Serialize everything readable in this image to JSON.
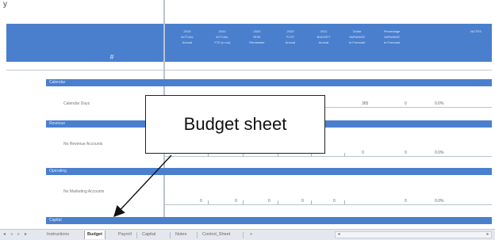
{
  "top_partial_text": "y",
  "header": {
    "hash": "#",
    "columns": [
      {
        "line1": "2019",
        "line2": "ACTUAL",
        "line3": "Annual"
      },
      {
        "line1": "2020",
        "line2": "ACTUAL",
        "line3": "YTD (n mo)"
      },
      {
        "line1": "2020",
        "line2": "RISK",
        "line3": "Remainder"
      },
      {
        "line1": "2020",
        "line2": "FCST",
        "line3": "Annual"
      },
      {
        "line1": "2021",
        "line2": "BUDGET",
        "line3": "Annual"
      },
      {
        "line1": "Dollar",
        "line2": "VARIANCE",
        "line3": "to Forecast"
      },
      {
        "line1": "Percentage",
        "line2": "VARIANCE",
        "line3": "to Forecast"
      },
      {
        "line1": "NOTES",
        "line2": "",
        "line3": ""
      }
    ]
  },
  "sections": [
    {
      "label": "Calendar",
      "row_label": "Calendar Days",
      "values": [
        "365",
        "0",
        "0.0%"
      ]
    },
    {
      "label": "Revenue",
      "row_label": "No Revenue Accounts",
      "values": [
        "0",
        "0",
        "0.0%"
      ]
    },
    {
      "label": "Operating",
      "row_label": "No Marketing Accounts",
      "values": [
        "0",
        "0",
        "0.0%"
      ]
    },
    {
      "label": "Capital",
      "row_label": "",
      "values": []
    }
  ],
  "callout": {
    "text": "Budget sheet"
  },
  "tabbar": {
    "nav": [
      "◂",
      "◃",
      "▹",
      "▸"
    ],
    "tabs": [
      "Instructions",
      "Budget",
      "Payroll",
      "Capital",
      "Notes",
      "Control_Sheet"
    ],
    "active_tab": "Budget",
    "add_tab": "+"
  },
  "colors": {
    "header_blue": "#4a7fce",
    "header_text": "#dfe9f8"
  }
}
